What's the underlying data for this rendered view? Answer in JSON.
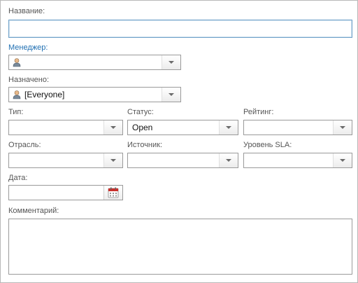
{
  "form": {
    "name": {
      "label": "Название:",
      "value": ""
    },
    "manager": {
      "label": "Менеджер:",
      "value": "",
      "icon": "user-icon"
    },
    "assigned": {
      "label": "Назначено:",
      "value": "[Everyone]",
      "icon": "user-icon"
    },
    "type": {
      "label": "Тип:",
      "value": ""
    },
    "status": {
      "label": "Статус:",
      "value": "Open"
    },
    "rating": {
      "label": "Рейтинг:",
      "value": ""
    },
    "industry": {
      "label": "Отрасль:",
      "value": ""
    },
    "source": {
      "label": "Источник:",
      "value": ""
    },
    "sla": {
      "label": "Уровень SLA:",
      "value": ""
    },
    "date": {
      "label": "Дата:",
      "value": "",
      "icon": "calendar-icon"
    },
    "comment": {
      "label": "Комментарий:",
      "value": ""
    }
  },
  "colors": {
    "label": "#555555",
    "link_label": "#1f6fb2",
    "field_border": "#9a9a9a",
    "focus_border": "#6da0c8",
    "calendar_red": "#c9302c"
  }
}
